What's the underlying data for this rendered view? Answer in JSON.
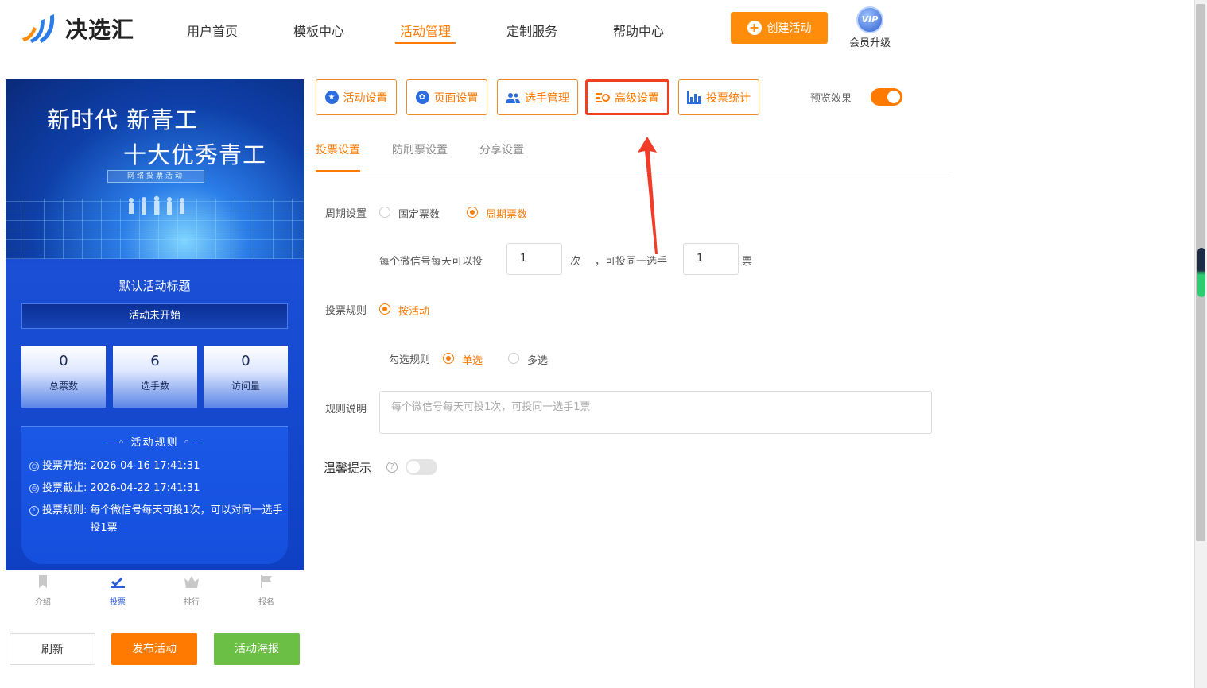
{
  "brand": {
    "name": "决选汇"
  },
  "nav": {
    "items": [
      "用户首页",
      "模板中心",
      "活动管理",
      "定制服务",
      "帮助中心"
    ],
    "active_index": 2
  },
  "header": {
    "create_label": "创建活动",
    "vip_badge": "VIP",
    "vip_label": "会员升级"
  },
  "preview": {
    "banner_line1": "新时代 新青工",
    "banner_line2": "十大优秀青工",
    "banner_line3": "网络投票活动",
    "title": "默认活动标题",
    "status": "活动未开始",
    "stats": [
      {
        "value": "0",
        "label": "总票数"
      },
      {
        "value": "6",
        "label": "选手数"
      },
      {
        "value": "0",
        "label": "访问量"
      }
    ],
    "rules_heading": "活动规则",
    "rules": [
      {
        "key": "投票开始:",
        "value": "2026-04-16 17:41:31"
      },
      {
        "key": "投票截止:",
        "value": "2026-04-22 17:41:31"
      },
      {
        "key": "投票规则:",
        "value": "每个微信号每天可投1次，可以对同一选手投1票"
      }
    ],
    "tabbar": [
      {
        "label": "介绍",
        "icon": "bookmark-icon"
      },
      {
        "label": "投票",
        "icon": "vote-icon"
      },
      {
        "label": "排行",
        "icon": "crown-icon"
      },
      {
        "label": "报名",
        "icon": "flag-icon"
      }
    ],
    "tabbar_active": 1
  },
  "actions": {
    "refresh": "刷新",
    "publish": "发布活动",
    "poster": "活动海报"
  },
  "toolbar": {
    "buttons": [
      "活动设置",
      "页面设置",
      "选手管理",
      "高级设置",
      "投票统计"
    ],
    "highlighted_index": 3,
    "preview_label": "预览效果",
    "preview_on": true
  },
  "subtabs": {
    "items": [
      "投票设置",
      "防刷票设置",
      "分享设置"
    ],
    "active_index": 0
  },
  "form": {
    "period_label": "周期设置",
    "period_options": [
      "固定票数",
      "周期票数"
    ],
    "period_selected": 1,
    "per_day_prefix": "每个微信号每天可以投",
    "per_day_value": "1",
    "per_day_unit": "次",
    "same_prefix": "，可投同一选手",
    "same_value": "1",
    "same_unit": "票",
    "rule_label": "投票规则",
    "rule_option": "按活动",
    "check_label": "勾选规则",
    "check_options": [
      "单选",
      "多选"
    ],
    "check_selected": 0,
    "desc_label": "规则说明",
    "desc_placeholder": "每个微信号每天可投1次，可投同一选手1票",
    "tip_label": "温馨提示",
    "tip_on": false
  },
  "colors": {
    "accent": "#ff7a00",
    "highlight_border": "#f04020",
    "green": "#6cbf45",
    "preview_blue": "#1a4fd6"
  }
}
